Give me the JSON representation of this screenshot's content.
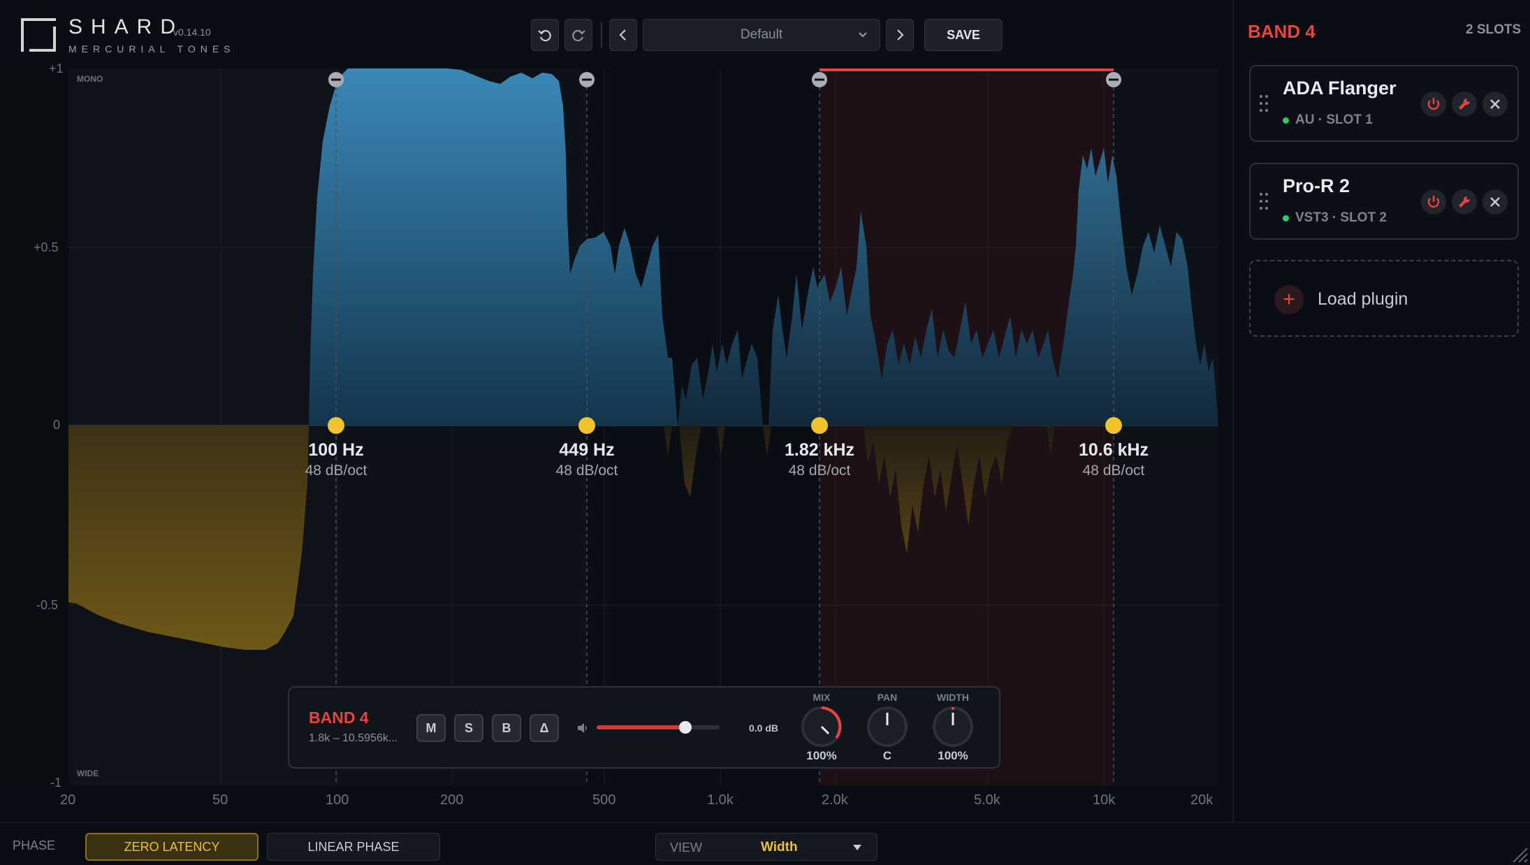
{
  "header": {
    "brand": "SHARD",
    "version": "v0.14.10",
    "subtitle": "MERCURIAL TONES",
    "preset": "Default",
    "save_label": "SAVE"
  },
  "graph": {
    "y_ticks": [
      "+1",
      "+0.5",
      "0",
      "-0.5",
      "-1"
    ],
    "x_ticks": [
      "20",
      "50",
      "100",
      "200",
      "500",
      "1.0k",
      "2.0k",
      "5.0k",
      "10k",
      "20k"
    ],
    "top_label": "MONO",
    "bottom_label": "WIDE",
    "crossovers": [
      {
        "freq": "100 Hz",
        "slope": "48 dB/oct"
      },
      {
        "freq": "449 Hz",
        "slope": "48 dB/oct"
      },
      {
        "freq": "1.82 kHz",
        "slope": "48 dB/oct"
      },
      {
        "freq": "10.6 kHz",
        "slope": "48 dB/oct"
      }
    ],
    "selected_band": 4,
    "colors": {
      "positive": "#3a86b4",
      "negative": "#a07c1c",
      "selected": "#e8433d",
      "handle": "#f0c22c"
    }
  },
  "band_panel": {
    "title": "BAND 4",
    "range": "1.8k – 10.5956k...",
    "buttons": [
      "M",
      "S",
      "B",
      "Δ"
    ],
    "gain": "0.0 dB",
    "gain_fraction": 0.72,
    "knobs": [
      {
        "label": "MIX",
        "value": "100%"
      },
      {
        "label": "PAN",
        "value": "C"
      },
      {
        "label": "WIDTH",
        "value": "100%"
      }
    ]
  },
  "sidebar": {
    "title": "BAND 4",
    "count": "2 SLOTS",
    "plugins": [
      {
        "name": "ADA Flanger",
        "meta": "AU · SLOT 1"
      },
      {
        "name": "Pro-R 2",
        "meta": "VST3 · SLOT 2"
      }
    ],
    "load_label": "Load plugin"
  },
  "bottom": {
    "phase_label": "PHASE",
    "zero_latency": "ZERO LATENCY",
    "linear_phase": "LINEAR PHASE",
    "view_label": "VIEW",
    "view_value": "Width"
  }
}
